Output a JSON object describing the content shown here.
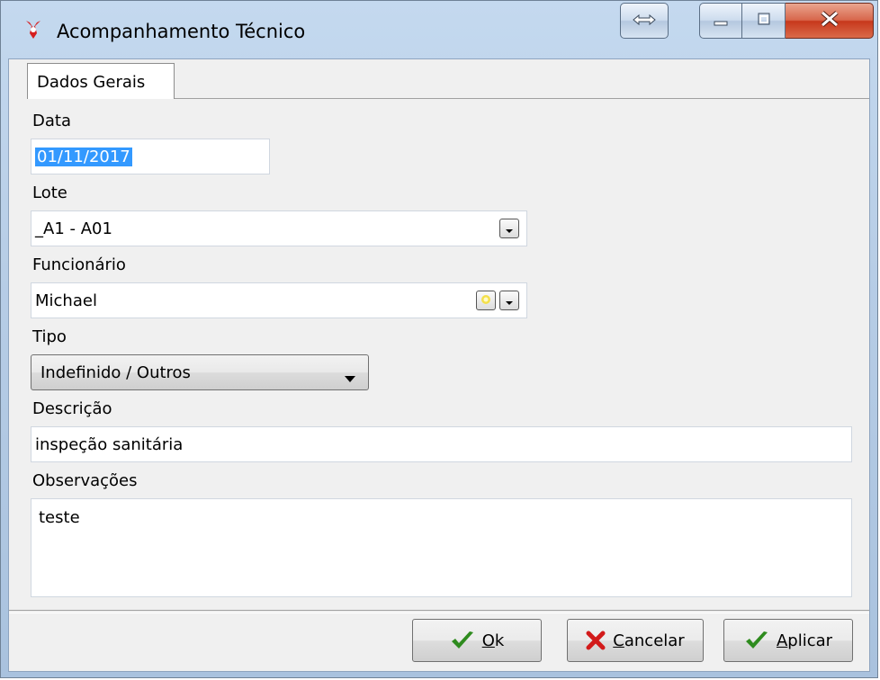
{
  "window": {
    "title": "Acompanhamento Técnico",
    "icons": {
      "app": "app-logo-icon",
      "resize": "resize-arrows-icon",
      "minimize": "minimize-icon",
      "maximize": "maximize-icon",
      "close": "close-icon"
    }
  },
  "tabs": [
    {
      "label": "Dados Gerais",
      "active": true
    }
  ],
  "form": {
    "data": {
      "label": "Data",
      "value": "01/11/2017"
    },
    "lote": {
      "label": "Lote",
      "value": "_A1 - A01"
    },
    "funcionario": {
      "label": "Funcionário",
      "value": "Michael"
    },
    "tipo": {
      "label": "Tipo",
      "value": "Indefinido / Outros"
    },
    "descricao": {
      "label": "Descrição",
      "value": "inspeção sanitária"
    },
    "observacoes": {
      "label": "Observações",
      "value": "teste"
    }
  },
  "buttons": {
    "ok": {
      "accel": "O",
      "rest": "k",
      "icon": "check-icon"
    },
    "cancelar": {
      "accel": "C",
      "rest": "ancelar",
      "icon": "x-icon"
    },
    "aplicar": {
      "accel": "A",
      "rest": "plicar",
      "icon": "check-icon"
    }
  },
  "colors": {
    "selection": "#3399ff",
    "check": "#2e8b1e",
    "cancel": "#d21a1a",
    "title_bg": "#b7cde6"
  }
}
